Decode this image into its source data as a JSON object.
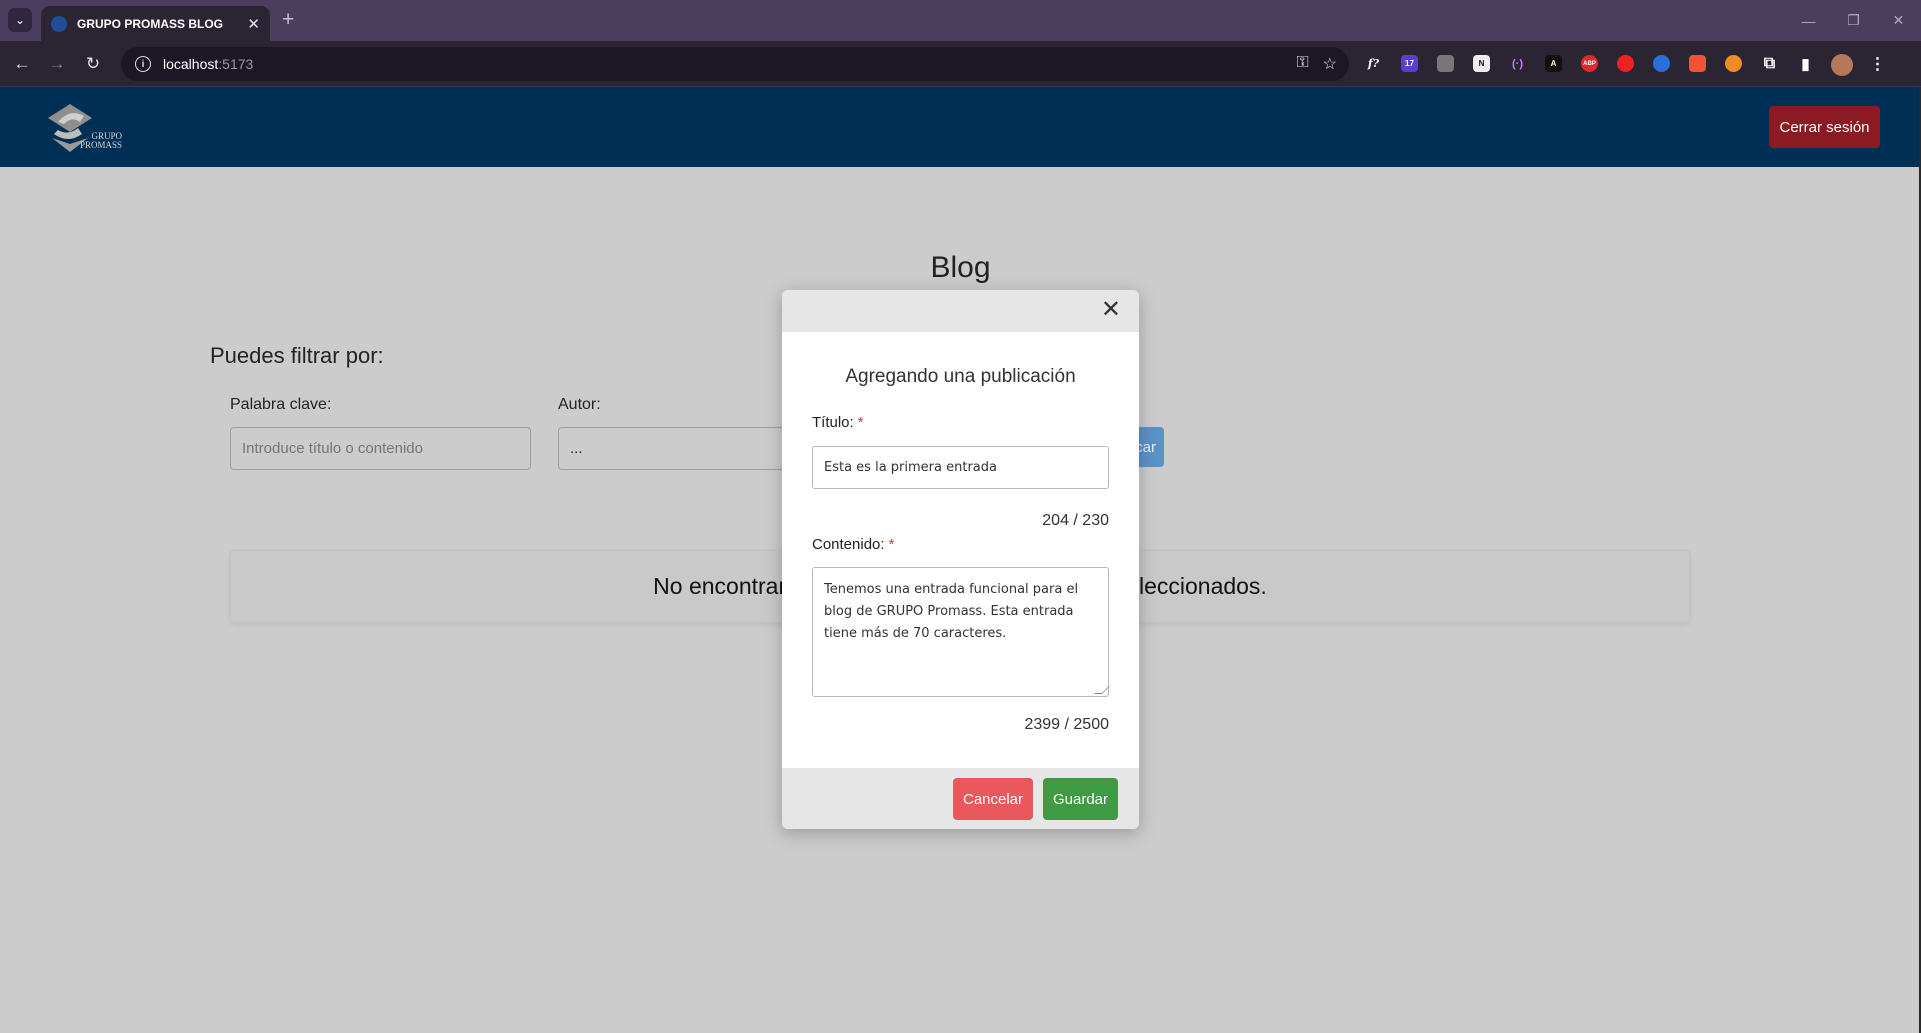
{
  "browser": {
    "tab_title": "GRUPO PROMASS BLOG",
    "url_host": "localhost",
    "url_port": ":5173",
    "extensions": [
      "f?",
      "17",
      "N",
      "(·)",
      "A",
      "ABP"
    ]
  },
  "header": {
    "logo_line1": "GRUPO",
    "logo_line2": "PROMASS",
    "logout_label": "Cerrar sesión"
  },
  "page": {
    "title": "Blog",
    "filter_title": "Puedes filtrar por:",
    "keyword_label": "Palabra clave:",
    "keyword_placeholder": "Introduce título o contenido",
    "author_label": "Autor:",
    "author_value": "...",
    "search_label": "car",
    "empty_message": "No encontramos publicaciones con los filtros seleccionados."
  },
  "modal": {
    "title": "Agregando una publicación",
    "title_label": "Título:",
    "title_value": "Esta es la primera entrada",
    "title_counter": "204 / 230",
    "content_label": "Contenido:",
    "content_value": "Tenemos una entrada funcional para el blog de GRUPO Promass. Esta entrada tiene más de 70 caracteres.",
    "content_counter": "2399 / 2500",
    "required_mark": "*",
    "cancel_label": "Cancelar",
    "save_label": "Guardar"
  }
}
